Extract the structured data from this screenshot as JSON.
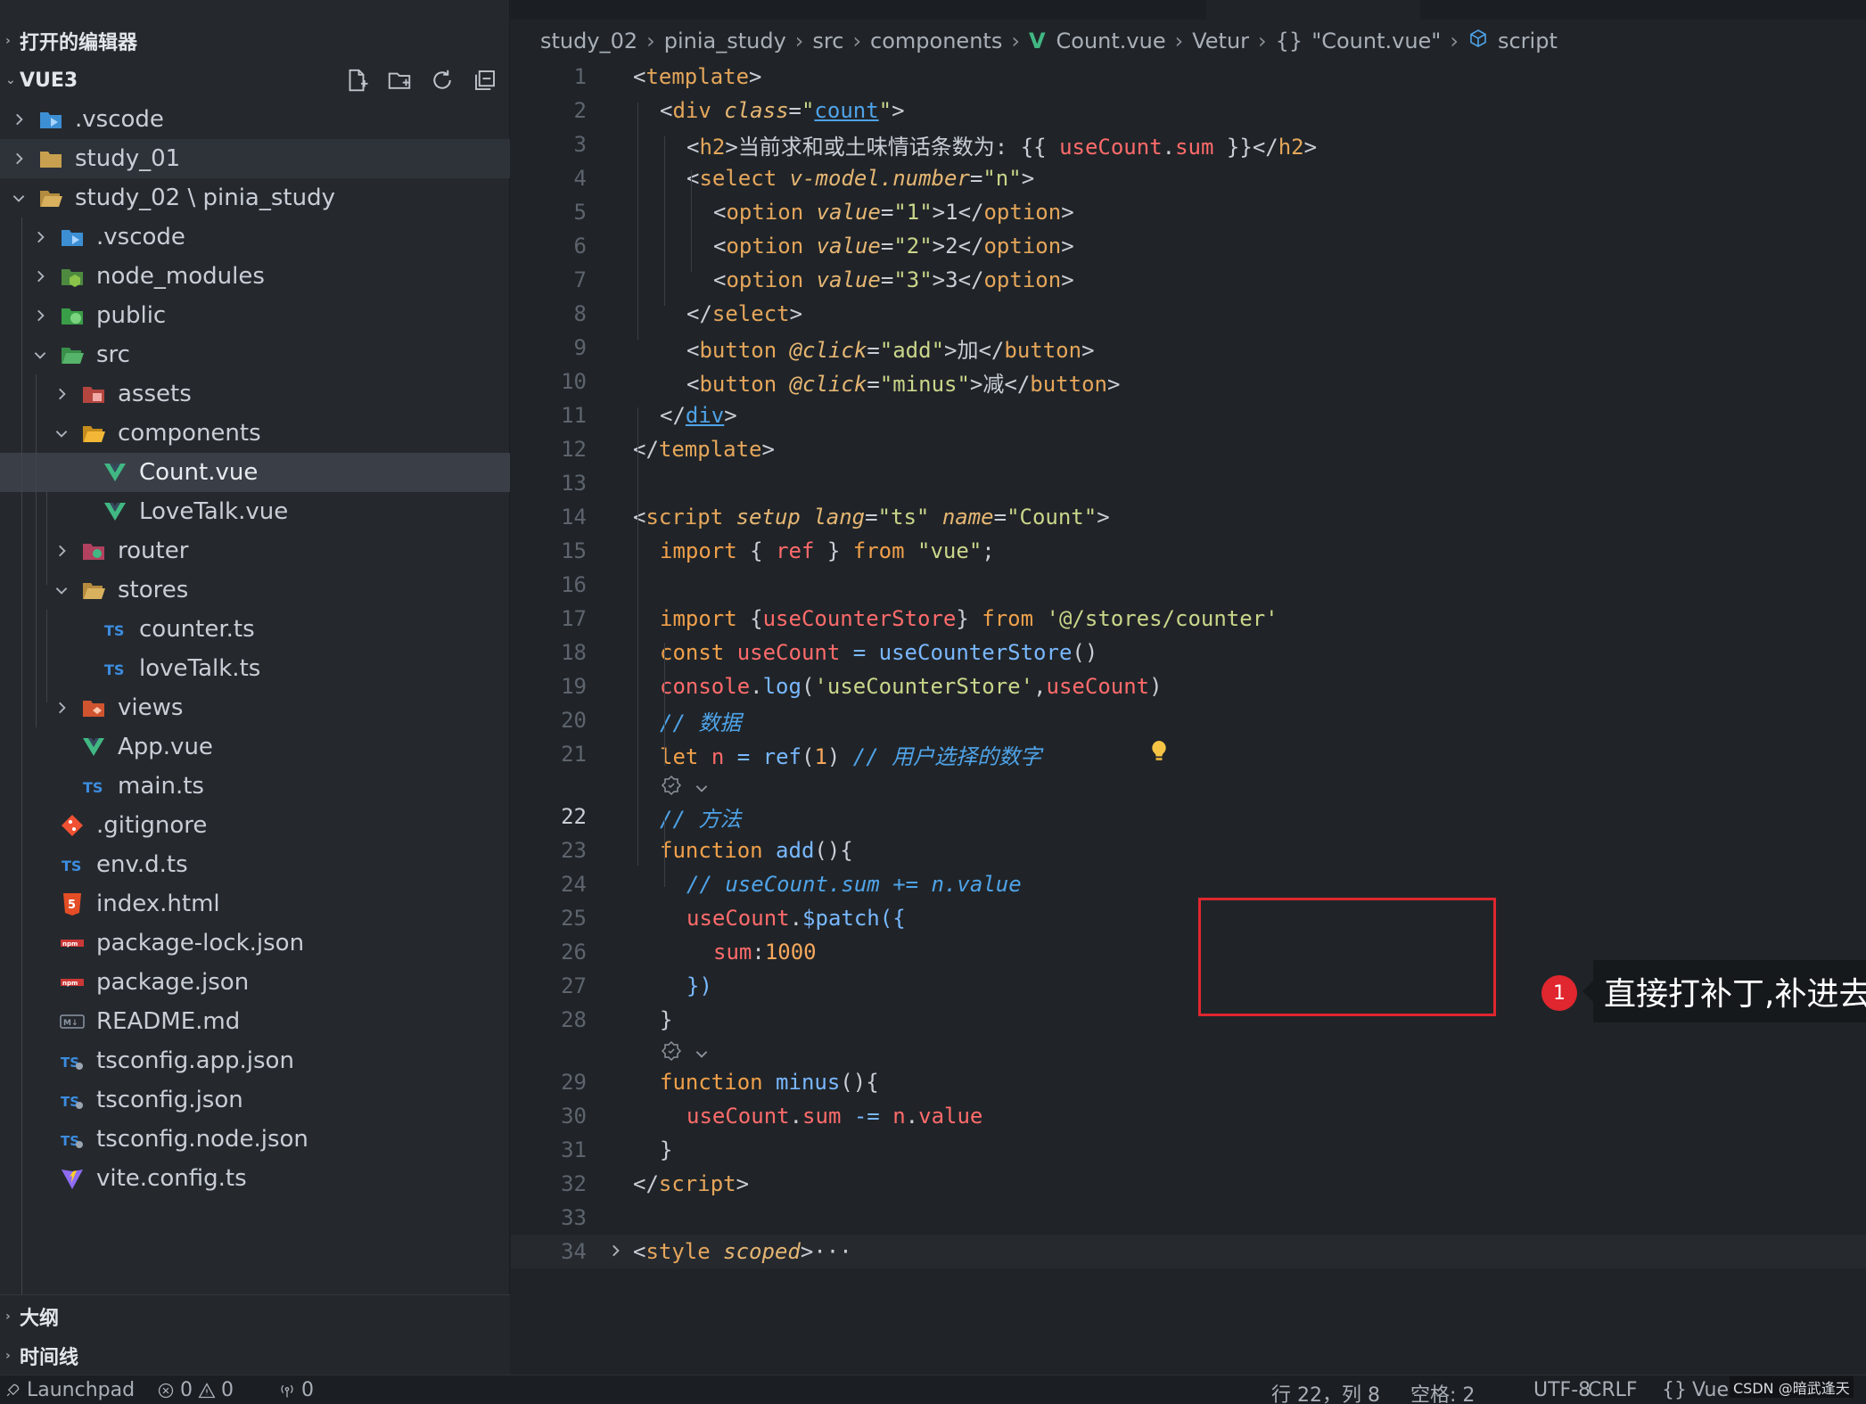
{
  "sidebar": {
    "open_editors_label": "打开的编辑器",
    "workspace_label": "VUE3",
    "outline_label": "大纲",
    "timeline_label": "时间线",
    "tree": [
      {
        "label": ".vscode",
        "depth": 0,
        "chevron": "right",
        "icon": "vscode-folder-icon"
      },
      {
        "label": "study_01",
        "depth": 0,
        "chevron": "right",
        "icon": "folder-icon"
      },
      {
        "label": "study_02 \\ pinia_study",
        "depth": 0,
        "chevron": "down",
        "icon": "folder-open-icon"
      },
      {
        "label": ".vscode",
        "depth": 1,
        "chevron": "right",
        "icon": "vscode-folder-icon"
      },
      {
        "label": "node_modules",
        "depth": 1,
        "chevron": "right",
        "icon": "node-folder-icon"
      },
      {
        "label": "public",
        "depth": 1,
        "chevron": "right",
        "icon": "public-folder-icon"
      },
      {
        "label": "src",
        "depth": 1,
        "chevron": "down",
        "icon": "src-folder-icon"
      },
      {
        "label": "assets",
        "depth": 2,
        "chevron": "right",
        "icon": "assets-folder-icon"
      },
      {
        "label": "components",
        "depth": 2,
        "chevron": "down",
        "icon": "components-folder-icon"
      },
      {
        "label": "Count.vue",
        "depth": 3,
        "chevron": "none",
        "icon": "vue-file-icon",
        "selected": true
      },
      {
        "label": "LoveTalk.vue",
        "depth": 3,
        "chevron": "none",
        "icon": "vue-file-icon"
      },
      {
        "label": "router",
        "depth": 2,
        "chevron": "right",
        "icon": "router-folder-icon"
      },
      {
        "label": "stores",
        "depth": 2,
        "chevron": "down",
        "icon": "folder-open-icon"
      },
      {
        "label": "counter.ts",
        "depth": 3,
        "chevron": "none",
        "icon": "ts-file-icon"
      },
      {
        "label": "loveTalk.ts",
        "depth": 3,
        "chevron": "none",
        "icon": "ts-file-icon"
      },
      {
        "label": "views",
        "depth": 2,
        "chevron": "right",
        "icon": "views-folder-icon"
      },
      {
        "label": "App.vue",
        "depth": 2,
        "chevron": "none",
        "icon": "vue-file-icon"
      },
      {
        "label": "main.ts",
        "depth": 2,
        "chevron": "none",
        "icon": "ts-file-icon"
      },
      {
        "label": ".gitignore",
        "depth": 1,
        "chevron": "none",
        "icon": "git-file-icon"
      },
      {
        "label": "env.d.ts",
        "depth": 1,
        "chevron": "none",
        "icon": "ts-file-icon"
      },
      {
        "label": "index.html",
        "depth": 1,
        "chevron": "none",
        "icon": "html-file-icon"
      },
      {
        "label": "package-lock.json",
        "depth": 1,
        "chevron": "none",
        "icon": "npm-file-icon"
      },
      {
        "label": "package.json",
        "depth": 1,
        "chevron": "none",
        "icon": "npm-file-icon"
      },
      {
        "label": "README.md",
        "depth": 1,
        "chevron": "none",
        "icon": "markdown-file-icon"
      },
      {
        "label": "tsconfig.app.json",
        "depth": 1,
        "chevron": "none",
        "icon": "tsconfig-file-icon"
      },
      {
        "label": "tsconfig.json",
        "depth": 1,
        "chevron": "none",
        "icon": "tsconfig-file-icon"
      },
      {
        "label": "tsconfig.node.json",
        "depth": 1,
        "chevron": "none",
        "icon": "tsconfig-file-icon"
      },
      {
        "label": "vite.config.ts",
        "depth": 1,
        "chevron": "none",
        "icon": "vite-file-icon"
      }
    ]
  },
  "breadcrumb": {
    "items": [
      "study_02",
      "pinia_study",
      "src",
      "components",
      "Count.vue",
      "Vetur",
      "\"Count.vue\"",
      "script"
    ]
  },
  "code": {
    "lines": [
      {
        "n": "1",
        "tokens": [
          [
            "k-br",
            "<"
          ],
          [
            "k-tag",
            "template"
          ],
          [
            "k-br",
            ">"
          ]
        ],
        "indent": 0
      },
      {
        "n": "2",
        "tokens": [
          [
            "k-br",
            "<"
          ],
          [
            "k-tag",
            "div"
          ],
          [
            "k-plain",
            " "
          ],
          [
            "k-attr",
            "class"
          ],
          [
            "k-plain",
            "="
          ],
          [
            "k-str",
            "\""
          ],
          [
            "k-str-u",
            "count"
          ],
          [
            "k-str",
            "\""
          ],
          [
            "k-br",
            ">"
          ]
        ],
        "indent": 1
      },
      {
        "n": "3",
        "tokens": [
          [
            "k-br",
            "<"
          ],
          [
            "k-tag",
            "h2"
          ],
          [
            "k-br",
            ">"
          ],
          [
            "k-plain",
            "当前求和或土味情话条数为: {{ "
          ],
          [
            "k-var",
            "useCount"
          ],
          [
            "k-plain",
            "."
          ],
          [
            "k-var",
            "sum"
          ],
          [
            "k-plain",
            " }}</"
          ],
          [
            "k-tag",
            "h2"
          ],
          [
            "k-br",
            ">"
          ]
        ],
        "indent": 2
      },
      {
        "n": "4",
        "tokens": [
          [
            "k-br",
            "<"
          ],
          [
            "k-tag",
            "select"
          ],
          [
            "k-plain",
            " "
          ],
          [
            "k-attr",
            "v-model.number"
          ],
          [
            "k-plain",
            "="
          ],
          [
            "k-str",
            "\"n\""
          ],
          [
            "k-br",
            ">"
          ]
        ],
        "indent": 2
      },
      {
        "n": "5",
        "tokens": [
          [
            "k-br",
            "<"
          ],
          [
            "k-tag",
            "option"
          ],
          [
            "k-plain",
            " "
          ],
          [
            "k-attr",
            "value"
          ],
          [
            "k-plain",
            "="
          ],
          [
            "k-str",
            "\"1\""
          ],
          [
            "k-br",
            ">"
          ],
          [
            "k-plain",
            "1</"
          ],
          [
            "k-tag",
            "option"
          ],
          [
            "k-br",
            ">"
          ]
        ],
        "indent": 3
      },
      {
        "n": "6",
        "tokens": [
          [
            "k-br",
            "<"
          ],
          [
            "k-tag",
            "option"
          ],
          [
            "k-plain",
            " "
          ],
          [
            "k-attr",
            "value"
          ],
          [
            "k-plain",
            "="
          ],
          [
            "k-str",
            "\"2\""
          ],
          [
            "k-br",
            ">"
          ],
          [
            "k-plain",
            "2</"
          ],
          [
            "k-tag",
            "option"
          ],
          [
            "k-br",
            ">"
          ]
        ],
        "indent": 3
      },
      {
        "n": "7",
        "tokens": [
          [
            "k-br",
            "<"
          ],
          [
            "k-tag",
            "option"
          ],
          [
            "k-plain",
            " "
          ],
          [
            "k-attr",
            "value"
          ],
          [
            "k-plain",
            "="
          ],
          [
            "k-str",
            "\"3\""
          ],
          [
            "k-br",
            ">"
          ],
          [
            "k-plain",
            "3</"
          ],
          [
            "k-tag",
            "option"
          ],
          [
            "k-br",
            ">"
          ]
        ],
        "indent": 3
      },
      {
        "n": "8",
        "tokens": [
          [
            "k-br",
            "</"
          ],
          [
            "k-tag",
            "select"
          ],
          [
            "k-br",
            ">"
          ]
        ],
        "indent": 2
      },
      {
        "n": "9",
        "tokens": [
          [
            "k-br",
            "<"
          ],
          [
            "k-tag",
            "button"
          ],
          [
            "k-plain",
            " "
          ],
          [
            "k-attr",
            "@click"
          ],
          [
            "k-plain",
            "="
          ],
          [
            "k-str",
            "\"add\""
          ],
          [
            "k-br",
            ">"
          ],
          [
            "k-plain",
            "加</"
          ],
          [
            "k-tag",
            "button"
          ],
          [
            "k-br",
            ">"
          ]
        ],
        "indent": 2
      },
      {
        "n": "10",
        "tokens": [
          [
            "k-br",
            "<"
          ],
          [
            "k-tag",
            "button"
          ],
          [
            "k-plain",
            " "
          ],
          [
            "k-attr",
            "@click"
          ],
          [
            "k-plain",
            "="
          ],
          [
            "k-str",
            "\"minus\""
          ],
          [
            "k-br",
            ">"
          ],
          [
            "k-plain",
            "减</"
          ],
          [
            "k-tag",
            "button"
          ],
          [
            "k-br",
            ">"
          ]
        ],
        "indent": 2
      },
      {
        "n": "11",
        "tokens": [
          [
            "k-br",
            "</"
          ],
          [
            "uline",
            "div"
          ],
          [
            "k-br",
            ">"
          ]
        ],
        "indent": 1
      },
      {
        "n": "12",
        "tokens": [
          [
            "k-br",
            "</"
          ],
          [
            "k-tag",
            "template"
          ],
          [
            "k-br",
            ">"
          ]
        ],
        "indent": 0
      },
      {
        "n": "13",
        "tokens": [],
        "indent": 0
      },
      {
        "n": "14",
        "tokens": [
          [
            "k-br",
            "<"
          ],
          [
            "k-tag",
            "script"
          ],
          [
            "k-plain",
            " "
          ],
          [
            "k-attr",
            "setup"
          ],
          [
            "k-plain",
            " "
          ],
          [
            "k-attr",
            "lang"
          ],
          [
            "k-plain",
            "="
          ],
          [
            "k-str",
            "\"ts\""
          ],
          [
            "k-plain",
            " "
          ],
          [
            "k-attr",
            "name"
          ],
          [
            "k-plain",
            "="
          ],
          [
            "k-str",
            "\"Count\""
          ],
          [
            "k-br",
            ">"
          ]
        ],
        "indent": 0
      },
      {
        "n": "15",
        "tokens": [
          [
            "k-kw",
            "import"
          ],
          [
            "k-plain",
            " { "
          ],
          [
            "k-var",
            "ref"
          ],
          [
            "k-plain",
            " } "
          ],
          [
            "k-kw",
            "from"
          ],
          [
            "k-plain",
            " "
          ],
          [
            "k-str",
            "\"vue\""
          ],
          [
            "k-plain",
            ";"
          ]
        ],
        "indent": 1
      },
      {
        "n": "16",
        "tokens": [],
        "indent": 0
      },
      {
        "n": "17",
        "tokens": [
          [
            "k-kw",
            "import"
          ],
          [
            "k-plain",
            " {"
          ],
          [
            "k-var",
            "useCounterStore"
          ],
          [
            "k-plain",
            "} "
          ],
          [
            "k-kw",
            "from"
          ],
          [
            "k-plain",
            " "
          ],
          [
            "k-str",
            "'@/stores/counter'"
          ]
        ],
        "indent": 1
      },
      {
        "n": "18",
        "tokens": [
          [
            "k-kw",
            "const"
          ],
          [
            "k-plain",
            " "
          ],
          [
            "k-var",
            "useCount"
          ],
          [
            "k-plain",
            " "
          ],
          [
            "k-op",
            "="
          ],
          [
            "k-plain",
            " "
          ],
          [
            "k-fn",
            "useCounterStore"
          ],
          [
            "k-plain",
            "()"
          ]
        ],
        "indent": 1
      },
      {
        "n": "19",
        "tokens": [
          [
            "k-var",
            "console"
          ],
          [
            "k-plain",
            "."
          ],
          [
            "k-fn",
            "log"
          ],
          [
            "k-plain",
            "("
          ],
          [
            "k-str",
            "'useCounterStore'"
          ],
          [
            "k-plain",
            ","
          ],
          [
            "k-var",
            "useCount"
          ],
          [
            "k-plain",
            ")"
          ]
        ],
        "indent": 1
      },
      {
        "n": "20",
        "tokens": [
          [
            "k-cm",
            "// 数据"
          ]
        ],
        "indent": 1
      },
      {
        "n": "21",
        "tokens": [
          [
            "k-kw",
            "let"
          ],
          [
            "k-plain",
            " "
          ],
          [
            "k-var",
            "n"
          ],
          [
            "k-plain",
            " "
          ],
          [
            "k-op",
            "="
          ],
          [
            "k-plain",
            " "
          ],
          [
            "k-fn",
            "ref"
          ],
          [
            "k-plain",
            "("
          ],
          [
            "k-num",
            "1"
          ],
          [
            "k-plain",
            ") "
          ],
          [
            "k-cm",
            "// 用户选择的数字"
          ]
        ],
        "indent": 1,
        "lens_after": true
      },
      {
        "n": "22",
        "tokens": [
          [
            "k-cm",
            "// 方法"
          ]
        ],
        "indent": 1,
        "current": true
      },
      {
        "n": "23",
        "tokens": [
          [
            "k-kw",
            "function"
          ],
          [
            "k-plain",
            " "
          ],
          [
            "k-fn",
            "add"
          ],
          [
            "k-plain",
            "(){"
          ]
        ],
        "indent": 1
      },
      {
        "n": "24",
        "tokens": [
          [
            "k-cm",
            "// useCount.sum += n.value"
          ]
        ],
        "indent": 2
      },
      {
        "n": "25",
        "tokens": [
          [
            "k-var",
            "useCount"
          ],
          [
            "k-plain",
            "."
          ],
          [
            "k-fn",
            "$patch"
          ],
          [
            "k-op",
            "({"
          ]
        ],
        "indent": 2
      },
      {
        "n": "26",
        "tokens": [
          [
            "k-var",
            "sum"
          ],
          [
            "k-plain",
            ":"
          ],
          [
            "k-num",
            "1000"
          ]
        ],
        "indent": 3
      },
      {
        "n": "27",
        "tokens": [
          [
            "k-op",
            "})"
          ]
        ],
        "indent": 2
      },
      {
        "n": "28",
        "tokens": [
          [
            "k-plain",
            "}"
          ]
        ],
        "indent": 1,
        "lens_after": true
      },
      {
        "n": "29",
        "tokens": [
          [
            "k-kw",
            "function"
          ],
          [
            "k-plain",
            " "
          ],
          [
            "k-fn",
            "minus"
          ],
          [
            "k-plain",
            "(){"
          ]
        ],
        "indent": 1
      },
      {
        "n": "30",
        "tokens": [
          [
            "k-var",
            "useCount"
          ],
          [
            "k-plain",
            "."
          ],
          [
            "k-var",
            "sum"
          ],
          [
            "k-plain",
            " "
          ],
          [
            "k-op",
            "-="
          ],
          [
            "k-plain",
            " "
          ],
          [
            "k-var",
            "n"
          ],
          [
            "k-plain",
            "."
          ],
          [
            "k-var",
            "value"
          ]
        ],
        "indent": 2
      },
      {
        "n": "31",
        "tokens": [
          [
            "k-plain",
            "}"
          ]
        ],
        "indent": 1
      },
      {
        "n": "32",
        "tokens": [
          [
            "k-br",
            "</"
          ],
          [
            "k-tag",
            "script"
          ],
          [
            "k-br",
            ">"
          ]
        ],
        "indent": 0
      },
      {
        "n": "33",
        "tokens": [],
        "indent": 0
      },
      {
        "n": "34",
        "tokens": [
          [
            "k-br",
            "<"
          ],
          [
            "k-tag",
            "style"
          ],
          [
            "k-plain",
            " "
          ],
          [
            "k-attr",
            "scoped"
          ],
          [
            "k-br",
            ">"
          ],
          [
            "k-plain",
            "···"
          ]
        ],
        "indent": 0,
        "folded": true
      }
    ]
  },
  "annotation": {
    "badge": "1",
    "callout": "直接打补丁,补进去对象数据相当于直接覆盖"
  },
  "statusbar": {
    "launchpad": "Launchpad",
    "errors": "0",
    "warnings": "0",
    "ports": "0",
    "cursor": "行 22，列 8",
    "spaces": "空格: 2",
    "encoding": "UTF-8",
    "eol": "CRLF",
    "language": "Vue",
    "watermark": "CSDN @暗武逢天"
  },
  "colors": {
    "vue": "#41b883",
    "ts": "#3c8de0",
    "annotation_red": "#e0262e"
  }
}
